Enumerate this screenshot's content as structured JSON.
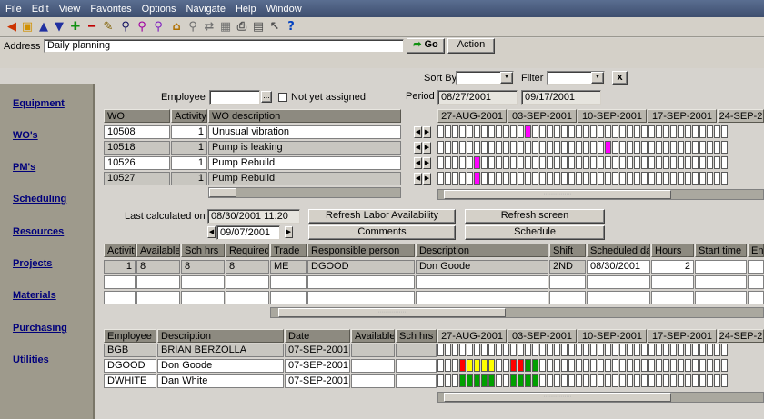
{
  "menu": [
    "File",
    "Edit",
    "View",
    "Favorites",
    "Options",
    "Navigate",
    "Help",
    "Window"
  ],
  "address": {
    "label": "Address",
    "value": "Daily planning",
    "go": "Go",
    "action": "Action"
  },
  "sortby": {
    "label": "Sort By",
    "filter_label": "Filter",
    "clear": "x"
  },
  "sidebar": [
    "Equipment",
    "WO's",
    "PM's",
    "Scheduling",
    "Resources",
    "Projects",
    "Materials",
    "Purchasing",
    "Utilities"
  ],
  "employee_filter": {
    "label": "Employee",
    "value": "",
    "dots": "...",
    "not_assigned": "Not yet assigned"
  },
  "period": {
    "label": "Period",
    "from": "08/27/2001",
    "to": "09/17/2001"
  },
  "wo_table": {
    "headers": [
      "WO",
      "Activity",
      "WO description"
    ],
    "rows": [
      {
        "wo": "10508",
        "activity": "1",
        "desc": "Unusual vibration"
      },
      {
        "wo": "10518",
        "activity": "1",
        "desc": "Pump is leaking"
      },
      {
        "wo": "10526",
        "activity": "1",
        "desc": "Pump Rebuild"
      },
      {
        "wo": "10527",
        "activity": "1",
        "desc": "Pump Rebuild"
      }
    ]
  },
  "week_headers": [
    "27-AUG-2001",
    "03-SEP-2001",
    "10-SEP-2001",
    "17-SEP-2001",
    "24-SEP-2"
  ],
  "week_headers2": [
    "27-AUG-2001",
    "03-SEP-2001",
    "10-SEP-2001",
    "17-SEP-2001",
    "24-SEP-2"
  ],
  "wo_grid": [
    [
      0,
      0,
      0,
      0,
      0,
      0,
      0,
      0,
      0,
      0,
      0,
      0,
      0,
      0,
      0,
      0,
      0,
      0,
      0,
      0,
      0,
      0,
      0,
      0,
      0,
      0,
      0,
      0,
      0,
      0,
      0,
      0,
      0,
      0,
      0,
      0,
      0,
      0,
      0,
      0,
      0,
      0,
      0
    ],
    [
      0,
      0,
      0,
      0,
      0,
      0,
      0,
      0,
      0,
      0,
      0,
      0,
      0,
      0,
      0,
      0,
      0,
      0,
      0,
      0,
      0,
      0,
      0,
      0,
      0,
      0,
      0,
      0,
      0,
      0,
      0,
      0,
      0,
      0,
      0,
      0,
      0,
      0,
      0,
      0,
      0,
      0,
      0
    ],
    [
      0,
      0,
      0,
      0,
      0,
      0,
      0,
      0,
      0,
      0,
      0,
      0,
      0,
      0,
      0,
      0,
      0,
      0,
      0,
      0,
      0,
      0,
      0,
      0,
      0,
      0,
      0,
      0,
      0,
      0,
      0,
      0,
      0,
      0,
      0,
      0,
      0,
      0,
      0,
      0,
      0,
      0,
      0
    ],
    [
      0,
      0,
      0,
      0,
      0,
      0,
      0,
      0,
      0,
      0,
      0,
      0,
      0,
      0,
      0,
      0,
      0,
      0,
      0,
      0,
      0,
      0,
      0,
      0,
      0,
      0,
      0,
      0,
      0,
      0,
      0,
      0,
      0,
      0,
      0,
      0,
      0,
      0,
      0,
      0,
      0,
      0,
      0
    ]
  ],
  "calc": {
    "label": "Last calculated on",
    "value": "08/30/2001 11:20",
    "date": "09/07/2001"
  },
  "buttons": {
    "refresh_labor": "Refresh Labor Availability",
    "refresh_screen": "Refresh screen",
    "comments": "Comments",
    "schedule": "Schedule"
  },
  "act_table": {
    "headers": [
      "Activity",
      "Available",
      "Sch hrs",
      "Required",
      "Trade",
      "Responsible person",
      "Description",
      "Shift",
      "Scheduled da",
      "Hours",
      "Start time",
      "En"
    ],
    "rows": [
      [
        "1",
        "8",
        "8",
        "8",
        "ME",
        "DGOOD",
        "Don Goode",
        "2ND",
        "08/30/2001",
        "2",
        "",
        ""
      ]
    ]
  },
  "emp_table": {
    "headers": [
      "Employee",
      "Description",
      "Date",
      "Available",
      "Sch hrs"
    ],
    "rows": [
      {
        "emp": "BGB",
        "desc": "BRIAN BERZOLLA",
        "date": "07-SEP-2001"
      },
      {
        "emp": "DGOOD",
        "desc": "Don Goode",
        "date": "07-SEP-2001"
      },
      {
        "emp": "DWHITE",
        "desc": "Dan White",
        "date": "07-SEP-2001"
      }
    ]
  },
  "colors": {
    "magenta": "#ff00ff",
    "red": "#ff0000",
    "yellow": "#ffff00",
    "green": "#00a000"
  }
}
